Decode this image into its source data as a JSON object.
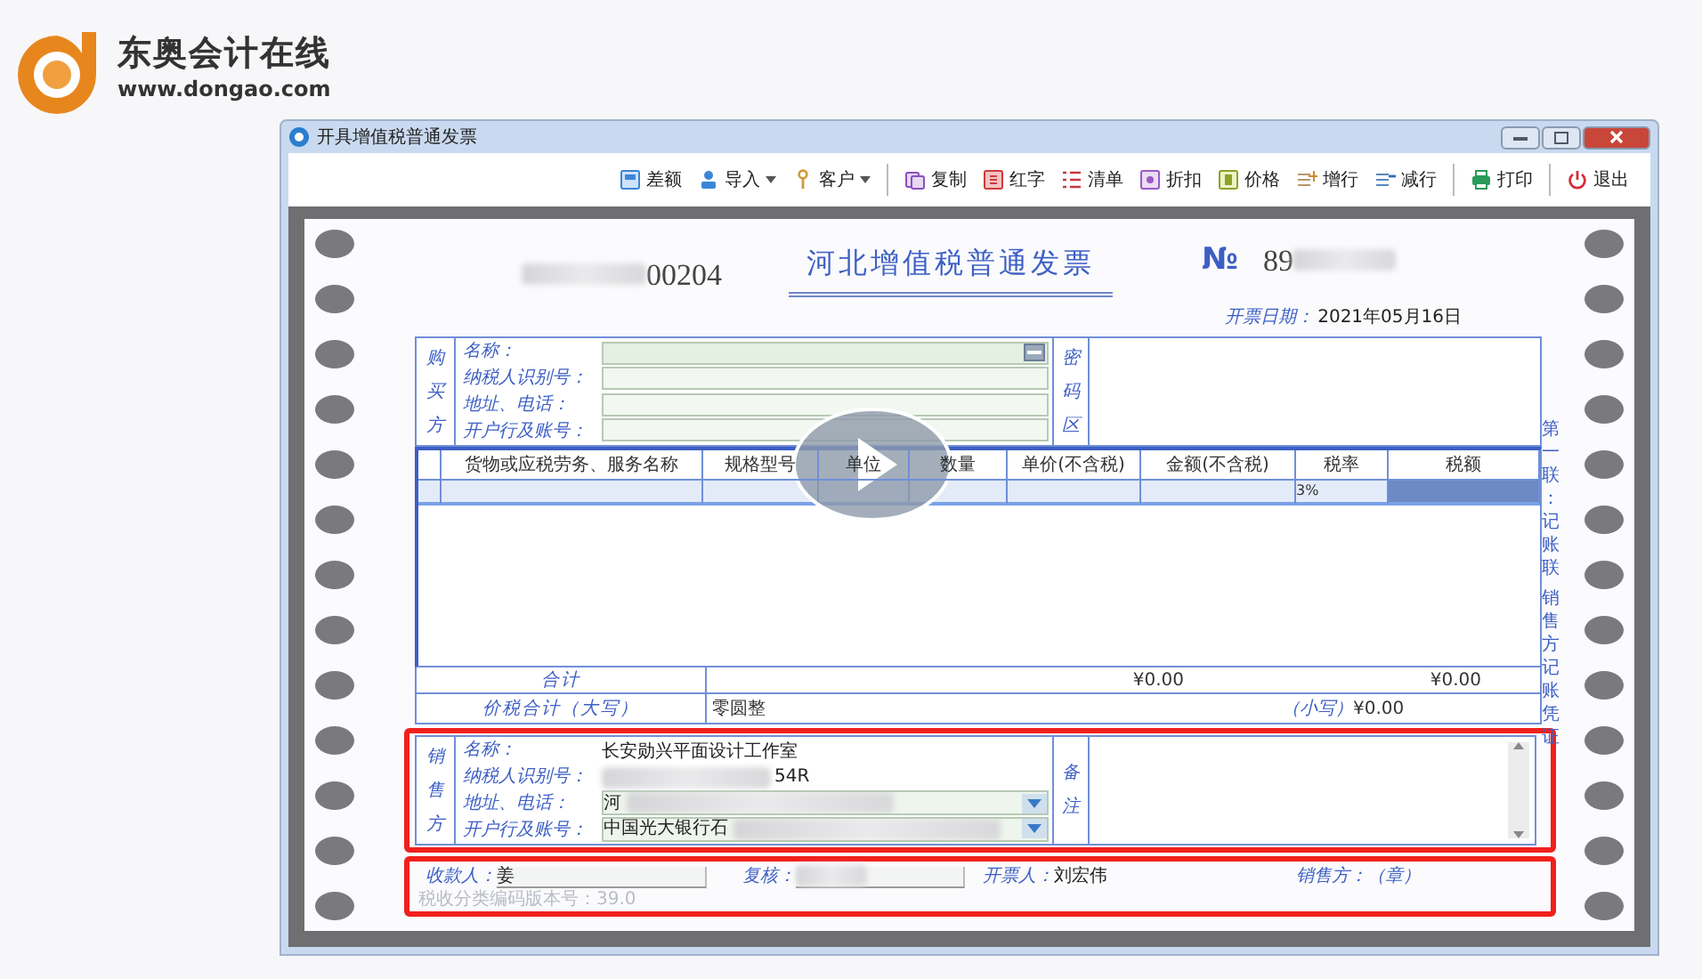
{
  "brand": {
    "name": "东奥会计在线",
    "url": "www.dongao.com"
  },
  "window": {
    "title": "开具增值税普通发票"
  },
  "toolbar": [
    {
      "label": "差额",
      "dropdown": false,
      "separator_before": false
    },
    {
      "label": "导入",
      "dropdown": true,
      "separator_before": false
    },
    {
      "label": "客户",
      "dropdown": true,
      "separator_before": false
    },
    {
      "label": "复制",
      "dropdown": false,
      "separator_before": true
    },
    {
      "label": "红字",
      "dropdown": false,
      "separator_before": false
    },
    {
      "label": "清单",
      "dropdown": false,
      "separator_before": false
    },
    {
      "label": "折扣",
      "dropdown": false,
      "separator_before": false
    },
    {
      "label": "价格",
      "dropdown": false,
      "separator_before": false
    },
    {
      "label": "增行",
      "dropdown": false,
      "separator_before": false
    },
    {
      "label": "减行",
      "dropdown": false,
      "separator_before": false
    },
    {
      "label": "打印",
      "dropdown": false,
      "separator_before": true
    },
    {
      "label": "退出",
      "dropdown": false,
      "separator_before": true
    }
  ],
  "invoice": {
    "code": "00204",
    "title": "河北增值税普通发票",
    "number_sign": "№",
    "number": "89",
    "date_label": "开票日期：",
    "date": "2021年05月16日",
    "buyer": {
      "side_label": "购买方",
      "fields": [
        {
          "label": "名称：",
          "kind": "lookup"
        },
        {
          "label": "纳税人识别号：",
          "kind": "input"
        },
        {
          "label": "地址、电话：",
          "kind": "input"
        },
        {
          "label": "开户行及账号：",
          "kind": "input"
        }
      ],
      "password_label": "密码区"
    },
    "goods": {
      "columns": [
        "货物或应税劳务、服务名称",
        "规格型号",
        "单位",
        "数量",
        "单价(不含税)",
        "金额(不含税)",
        "税率",
        "税额"
      ],
      "rows": [
        {
          "tax_rate": "3%"
        }
      ]
    },
    "totals": {
      "label": "合计",
      "amount": "¥0.00",
      "tax": "¥0.00"
    },
    "grand_total": {
      "label": "价税合计（大写）",
      "words": "零圆整",
      "figures_label": "（小写）",
      "figures": "¥0.00"
    },
    "seller": {
      "side_label": "销售方",
      "fields": [
        {
          "label": "名称：",
          "kind": "text",
          "value": "长安勋兴平面设计工作室",
          "redacted": false
        },
        {
          "label": "纳税人识别号：",
          "kind": "text",
          "value": "54R",
          "redacted": true
        },
        {
          "label": "地址、电话：",
          "kind": "dropdown",
          "value": "河",
          "redacted": true
        },
        {
          "label": "开户行及账号：",
          "kind": "dropdown",
          "value": "中国光大银行石",
          "redacted": true
        }
      ],
      "remarks_label": "备注"
    },
    "footer": {
      "payee_label": "收款人：",
      "payee": "姜",
      "reviewer_label": "复核：",
      "issuer_label": "开票人：",
      "issuer": "刘宏伟",
      "seal": "销售方：（章）"
    },
    "version": "税收分类编码版本号：39.0",
    "copy_label": [
      "第一联：记账联",
      "销售方记账凭证"
    ]
  }
}
